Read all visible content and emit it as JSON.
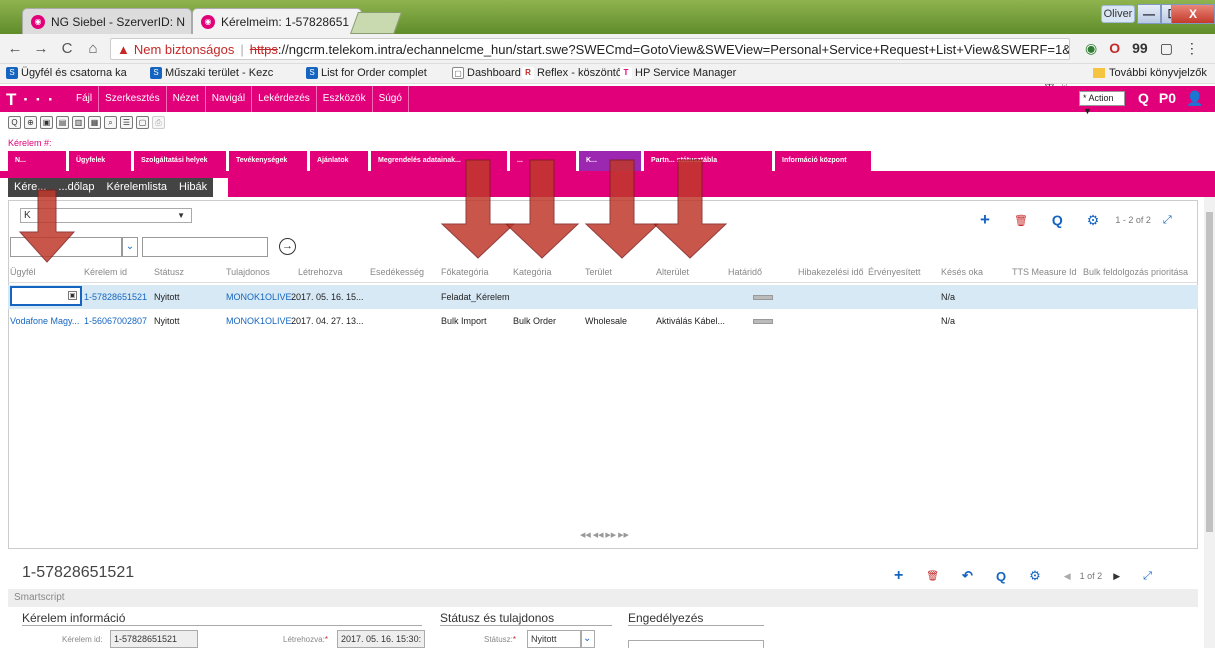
{
  "browser": {
    "tabs": [
      {
        "label": "NG Siebel - SzerverID: N",
        "close": "×"
      },
      {
        "label": "Kérelmeim: 1-57828651",
        "close": "×"
      }
    ],
    "user_chip": "Oliver",
    "window_buttons": {
      "minimize": "—",
      "maximize": "☐",
      "close": "X"
    },
    "nav": {
      "back": "←",
      "forward": "→",
      "reload": "C",
      "home": "⌂"
    },
    "address": {
      "warning": "▲",
      "not_secure": "Nem biztonságos",
      "separator": "|",
      "scheme": "https",
      "rest": "://ngcrm.telekom.intra/echannelcme_hun/start.swe?SWECmd=GotoView&SWEView=Personal+Service+Request+List+View&SWERF=1&S"
    },
    "url_icons": "⊕ ☆",
    "extensions": [
      "◉",
      "O",
      "99",
      "▢",
      "⋮"
    ],
    "bookmarks": [
      {
        "label": "Ügyfél és csatorna ka",
        "icon": "S"
      },
      {
        "label": "Műszaki terület - Kezc",
        "icon": "S"
      },
      {
        "label": "List for Order complet",
        "icon": "S"
      },
      {
        "label": "Dashboard",
        "icon": "▢"
      },
      {
        "label": "Reflex - köszöntő",
        "icon": "R"
      },
      {
        "label": "HP Service Manager",
        "icon": "T"
      }
    ],
    "bookmarks_other": "További könyvjelzők"
  },
  "app": {
    "logo": "T · · ·",
    "menu": [
      "Fájl",
      "Szerkesztés",
      "Nézet",
      "Navigál",
      "Lekérdezés",
      "Eszközök",
      "Súgó"
    ],
    "action": "* Action ▼",
    "icons": [
      "Q",
      "P0",
      "👤"
    ],
    "toolbar_icons": [
      "Q",
      "⊕",
      "▣",
      "▤",
      "▥",
      "▦",
      "⌕",
      "☰",
      "▢",
      "⎙"
    ],
    "record_hash": "Kérelem #:",
    "screen_tabs": [
      "N...",
      "Ügyfelek",
      "Szolgáltatási helyek",
      "Tevékenységek",
      "Ajánlatok",
      "Megrendelés adatainak...",
      "...",
      "K...",
      "Partn... státusztábla",
      "Információ központ"
    ],
    "view_tabs": [
      "Kére...",
      "...dőlap",
      "Kérelemlista",
      "Hibák"
    ]
  },
  "list": {
    "query_value": "K",
    "query_dropdown": "▼",
    "filter_dropdown": "⌄",
    "go_icon": "→",
    "toolbar": {
      "add": "+",
      "delete": "🗑",
      "search": "Q",
      "settings": "⚙",
      "pager": "1 - 2 of 2",
      "expand": "⤢"
    },
    "columns": [
      "Ügyfél",
      "Kérelem id",
      "Státusz",
      "Tulajdonos",
      "Létrehozva",
      "Esedékesség",
      "Főkategória",
      "Kategória",
      "Terület",
      "Alterület",
      "Határidő",
      "Hibakezelési idő",
      "Érvényesített",
      "Késés oka",
      "TTS Measure Id",
      "Bulk feldolgozás prioritása"
    ],
    "rows": [
      {
        "ugyfel": "",
        "id": "1-57828651521",
        "status": "Nyitott",
        "owner": "MONOK1OLIVE...",
        "created": "2017. 05. 16. 15...",
        "fokategoria": "Feladat_Kérelem",
        "kategoria": "",
        "terulet": "",
        "alterulet": "",
        "keses": "N/a"
      },
      {
        "ugyfel": "Vodafone Magy...",
        "id": "1-56067002807",
        "status": "Nyitott",
        "owner": "MONOK1OLIVE...",
        "created": "2017. 04. 27. 13...",
        "fokategoria": "Bulk Import",
        "kategoria": "Bulk Order",
        "terulet": "Wholesale",
        "alterulet": "Aktiválás Kábel...",
        "keses": "N/a"
      }
    ],
    "pager": "◀◀  ◀◀  ▶▶  ▶▶"
  },
  "form": {
    "title": "1-57828651521",
    "toolbar": {
      "add": "+",
      "delete": "🗑",
      "undo": "↶",
      "search": "Q",
      "settings": "⚙",
      "prev": "◀",
      "pager": "1 of 2",
      "next": "▶",
      "expand": "⤢"
    },
    "smartscript": "Smartscript",
    "sections": [
      "Kérelem információ",
      "Státusz és tulajdonos",
      "Engedélyezés"
    ],
    "fields": {
      "kerelem_id_label": "Kérelem id:",
      "kerelem_id_value": "1-57828651521",
      "letrehozva_label": "Létrehozva:",
      "letrehozva_value": "2017. 05. 16. 15:30:",
      "statusz_label": "Státusz:",
      "statusz_value": "Nyitott",
      "required_mark": "*"
    }
  },
  "colors": {
    "brand": "#e2007a",
    "active_tab": "#9c27b0",
    "selection": "#d7e9f5",
    "link": "#1565c0",
    "arrow": "#c0392b"
  }
}
